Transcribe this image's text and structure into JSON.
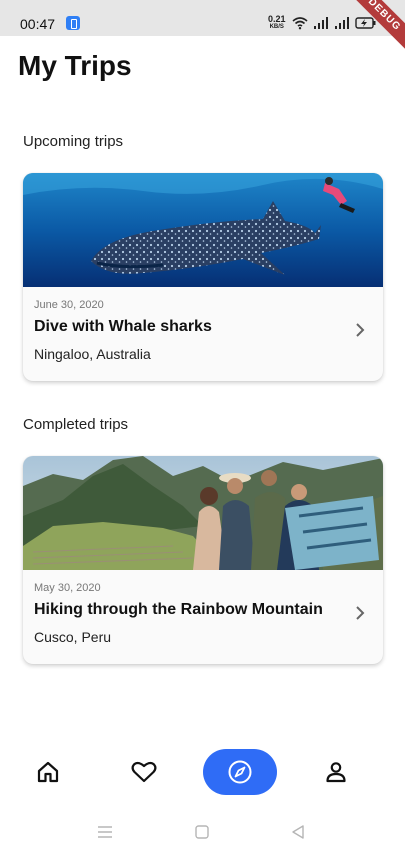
{
  "status_bar": {
    "time": "00:47",
    "speed_value": "0.21",
    "speed_unit": "KB/S"
  },
  "debug_banner": "DEBUG",
  "page": {
    "title": "My Trips"
  },
  "sections": {
    "upcoming_title": "Upcoming trips",
    "completed_title": "Completed trips"
  },
  "upcoming_trip": {
    "date": "June 30, 2020",
    "name": "Dive with Whale sharks",
    "location": "Ningaloo, Australia",
    "image_icon": "whale-shark-photo"
  },
  "completed_trip": {
    "date": "May 30, 2020",
    "name": "Hiking through the Rainbow Mountain",
    "location": "Cusco, Peru",
    "image_icon": "machu-picchu-group-photo"
  },
  "bottom_nav": {
    "items": [
      {
        "icon": "home-icon",
        "active": false
      },
      {
        "icon": "heart-icon",
        "active": false
      },
      {
        "icon": "compass-icon",
        "active": true
      },
      {
        "icon": "person-icon",
        "active": false
      }
    ],
    "accent_color": "#2f6cf6"
  },
  "system_nav": {
    "icons": [
      "menu-icon",
      "square-home-icon",
      "back-triangle-icon"
    ]
  }
}
